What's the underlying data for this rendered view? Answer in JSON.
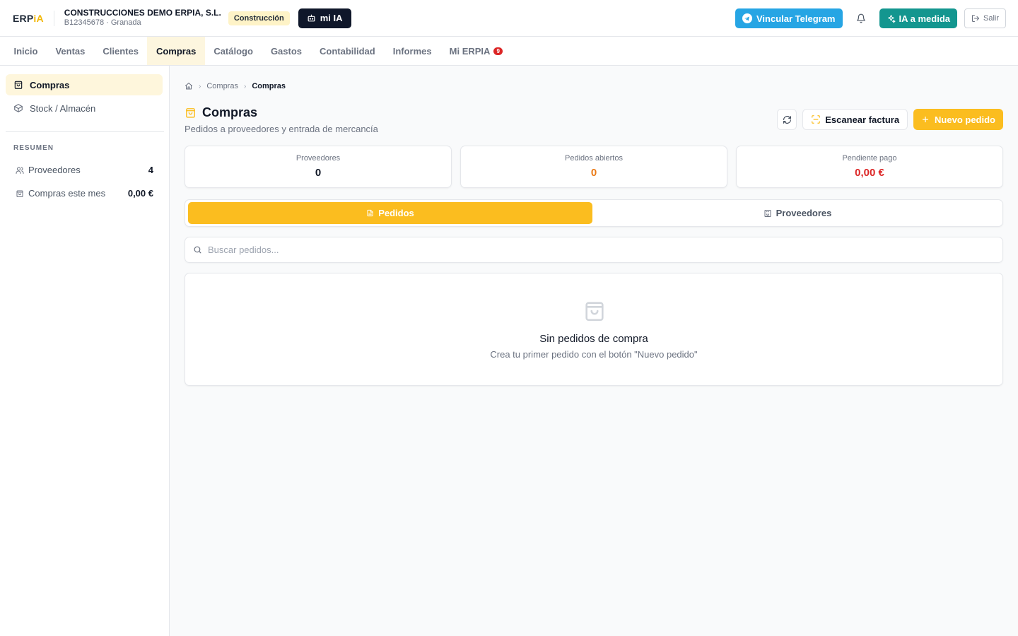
{
  "header": {
    "logo_main": "ERP",
    "logo_accent": "iA",
    "company_name": "CONSTRUCCIONES DEMO ERPIA, S.L.",
    "company_sub": "B12345678 · Granada",
    "sector_badge": "Construcción",
    "mia_label": "mi IA",
    "telegram_label": "Vincular Telegram",
    "ia_medida_label": "IA a medida",
    "salir_label": "Salir"
  },
  "nav": {
    "items": [
      "Inicio",
      "Ventas",
      "Clientes",
      "Compras",
      "Catálogo",
      "Gastos",
      "Contabilidad",
      "Informes",
      "Mi ERPIA"
    ],
    "active": "Compras",
    "badge": "9"
  },
  "sidebar": {
    "items": [
      {
        "label": "Compras",
        "icon": "shopping-bag-icon",
        "active": true
      },
      {
        "label": "Stock / Almacén",
        "icon": "box-icon",
        "active": false
      }
    ],
    "summary_heading": "RESUMEN",
    "summary": [
      {
        "label": "Proveedores",
        "icon": "users-icon",
        "value": "4"
      },
      {
        "label": "Compras este mes",
        "icon": "shopping-bag-icon",
        "value": "0,00 €"
      }
    ]
  },
  "breadcrumb": {
    "items": [
      "Compras",
      "Compras"
    ]
  },
  "page": {
    "title": "Compras",
    "subtitle": "Pedidos a proveedores y entrada de mercancía",
    "scan_label": "Escanear factura",
    "new_label": "Nuevo pedido"
  },
  "stats": [
    {
      "label": "Proveedores",
      "value": "0",
      "color": "#111827"
    },
    {
      "label": "Pedidos abiertos",
      "value": "0",
      "color": "#ea7a16"
    },
    {
      "label": "Pendiente pago",
      "value": "0,00 €",
      "color": "#dc2626"
    }
  ],
  "tabs": {
    "pedidos": "Pedidos",
    "proveedores": "Proveedores",
    "active": "Pedidos"
  },
  "search": {
    "placeholder": "Buscar pedidos...",
    "value": ""
  },
  "empty_state": {
    "title": "Sin pedidos de compra",
    "subtitle": "Crea tu primer pedido con el botón \"Nuevo pedido\""
  },
  "colors": {
    "accent": "#fbbd1f",
    "telegram": "#26a5e4",
    "ia": "#13968f",
    "dark": "#0f172a"
  }
}
